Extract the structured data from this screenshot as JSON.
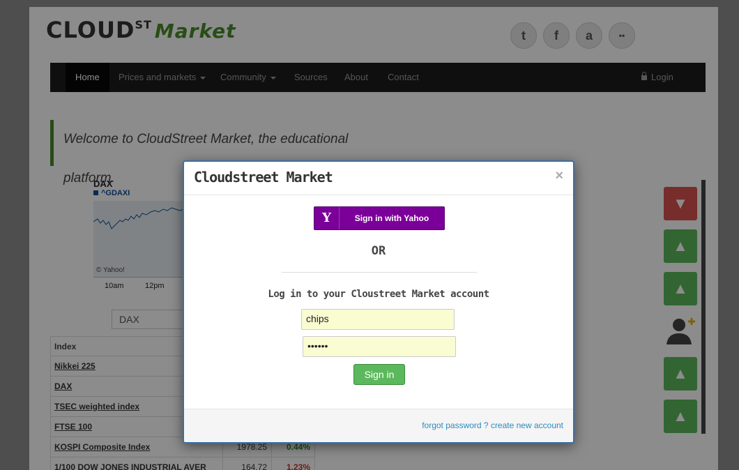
{
  "brand": {
    "main": "CLOUD",
    "sup": "ST",
    "accent": "Market"
  },
  "social": [
    {
      "name": "twitter-icon",
      "glyph": "t"
    },
    {
      "name": "facebook-icon",
      "glyph": "f"
    },
    {
      "name": "amazon-icon",
      "glyph": "a"
    },
    {
      "name": "flickr-icon",
      "glyph": "••"
    }
  ],
  "nav": {
    "home": "Home",
    "prices": "Prices and markets",
    "community": "Community",
    "sources": "Sources",
    "about": "About",
    "contact": "Contact",
    "login": "Login"
  },
  "welcome": "Welcome to CloudStreet Market, the educational platform.",
  "chart": {
    "name": "DAX",
    "ticker": "^GDAXI",
    "credit": "© Yahoo!",
    "ticks": [
      "10am",
      "12pm"
    ]
  },
  "index_search": {
    "value": "DAX"
  },
  "table": {
    "header": "Index",
    "rows": [
      {
        "name": "Nikkei 225",
        "value": "",
        "change": ""
      },
      {
        "name": "DAX",
        "value": "",
        "change": ""
      },
      {
        "name": "TSEC weighted index",
        "value": "",
        "change": ""
      },
      {
        "name": "FTSE 100",
        "value": "",
        "change": ""
      },
      {
        "name": "KOSPI Composite Index",
        "value": "1978.25",
        "change": "0.44%"
      },
      {
        "name": "1/100 DOW JONES INDUSTRIAL AVER",
        "value": "164.72",
        "change": "1.23%"
      }
    ]
  },
  "colors": {
    "accent_green": "#4a8d2a",
    "yahoo_purple": "#7b0099",
    "signin_green": "#5cb85c",
    "link_blue": "#2a8bc0",
    "down_red": "#d9534f"
  },
  "modal": {
    "title": "Cloudstreet Market",
    "close": "×",
    "yahoo_logo": "Y",
    "yahoo_label": "Sign in with Yahoo",
    "or": "OR",
    "login_heading": "Log in to your Cloustreet Market account",
    "username_value": "chips",
    "password_value": "••••••",
    "signin_label": "Sign in",
    "forgot_password": "forgot password ?",
    "create_account": "create new account"
  }
}
